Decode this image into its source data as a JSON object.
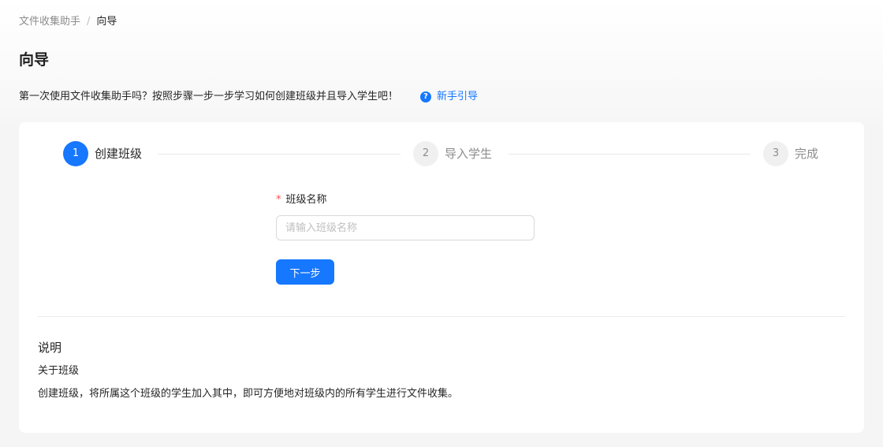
{
  "breadcrumb": {
    "root": "文件收集助手",
    "separator": "/",
    "current": "向导"
  },
  "page_title": "向导",
  "intro": {
    "text": "第一次使用文件收集助手吗？按照步骤一步一步学习如何创建班级并且导入学生吧！",
    "guide_icon": "question-circle-icon",
    "guide_link": "新手引导"
  },
  "steps": [
    {
      "number": "1",
      "label": "创建班级",
      "status": "active"
    },
    {
      "number": "2",
      "label": "导入学生",
      "status": "wait"
    },
    {
      "number": "3",
      "label": "完成",
      "status": "wait"
    }
  ],
  "form": {
    "required_mark": "*",
    "field_label": "班级名称",
    "field_value": "",
    "field_placeholder": "请输入班级名称",
    "next_label": "下一步"
  },
  "notes": {
    "title": "说明",
    "subtitle": "关于班级",
    "body": "创建班级，将所属这个班级的学生加入其中，即可方便地对班级内的所有学生进行文件收集。"
  },
  "colors": {
    "primary": "#1677ff",
    "required": "#ff4d4f",
    "background": "#f5f5f5",
    "card": "#ffffff"
  }
}
